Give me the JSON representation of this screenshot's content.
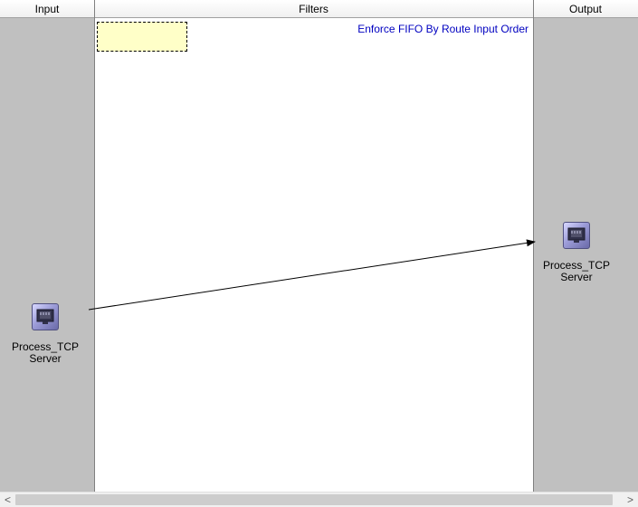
{
  "headers": {
    "input": "Input",
    "filters": "Filters",
    "output": "Output"
  },
  "filters_lane": {
    "caption": "Enforce FIFO By Route Input Order"
  },
  "input_node": {
    "label_line1": "Process_TCP",
    "label_line2": "Server",
    "icon": "network-port-icon"
  },
  "output_node": {
    "label_line1": "Process_TCP",
    "label_line2": "Server",
    "icon": "network-port-icon"
  },
  "scrollbar": {
    "left_arrow": "<",
    "right_arrow": ">"
  },
  "colors": {
    "lane_gray": "#c0c0c0",
    "lane_white": "#ffffff",
    "caption_blue": "#0000c0",
    "note_yellow": "#ffffc8"
  }
}
